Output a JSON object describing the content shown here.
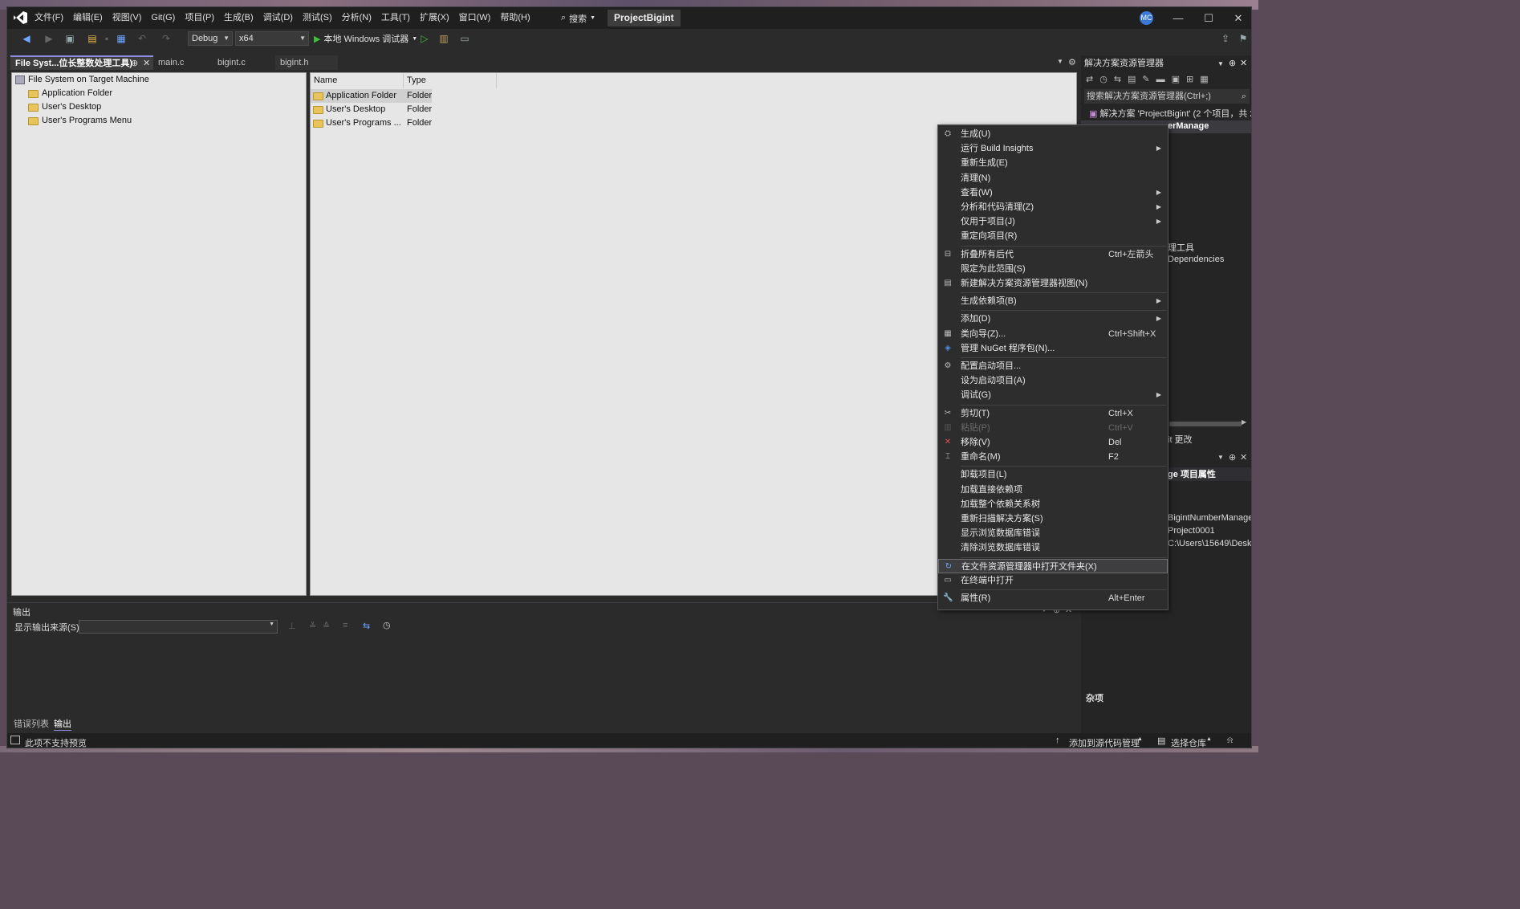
{
  "title": {
    "menus": [
      "文件(F)",
      "编辑(E)",
      "视图(V)",
      "Git(G)",
      "项目(P)",
      "生成(B)",
      "调试(D)",
      "测试(S)",
      "分析(N)",
      "工具(T)",
      "扩展(X)",
      "窗口(W)",
      "帮助(H)"
    ],
    "search": "搜索",
    "project": "ProjectBigint",
    "avatar": "MC"
  },
  "toolbar": {
    "config": "Debug",
    "platform": "x64",
    "run": "本地 Windows 调试器"
  },
  "tabs": [
    "File Syst...位长整数处理工具)",
    "main.c",
    "bigint.c",
    "bigint.h"
  ],
  "fs_tree": {
    "root": "File System on Target Machine",
    "children": [
      "Application Folder",
      "User's Desktop",
      "User's Programs Menu"
    ]
  },
  "fs_list": {
    "columns": [
      "Name",
      "Type"
    ],
    "rows": [
      {
        "name": "Application Folder",
        "type": "Folder"
      },
      {
        "name": "User's Desktop",
        "type": "Folder"
      },
      {
        "name": "User's Programs ...",
        "type": "Folder"
      }
    ]
  },
  "output": {
    "title": "输出",
    "source_label": "显示输出来源(S):"
  },
  "bottom_tabs": [
    "错误列表",
    "输出"
  ],
  "status": {
    "left": "此项不支持预览",
    "add_source": "添加到源代码管理",
    "select_repo": "选择仓库"
  },
  "solution_explorer": {
    "title": "解决方案资源管理器",
    "search_placeholder": "搜索解决方案资源管理器(Ctrl+;)",
    "solution": "解决方案 'ProjectBigint' (2 个项目，共 2",
    "project_partial": "erManage",
    "frag1": "理工具",
    "frag2": "Dependencies",
    "frag3": "it 更改",
    "frag4": "ge 项目属性",
    "frag5": "BigintNumberManage",
    "frag6": "Project0001",
    "frag7": "C:\\Users\\15649\\Deskt",
    "misc": "杂项"
  },
  "context_menu": {
    "items": [
      {
        "label": "生成(U)",
        "icon": "build-icon"
      },
      {
        "label": "运行 Build Insights",
        "sub": true
      },
      {
        "label": "重新生成(E)"
      },
      {
        "label": "清理(N)"
      },
      {
        "label": "查看(W)",
        "sub": true
      },
      {
        "label": "分析和代码清理(Z)",
        "sub": true
      },
      {
        "label": "仅用于项目(J)",
        "sub": true
      },
      {
        "label": "重定向项目(R)"
      },
      {
        "sep": true
      },
      {
        "label": "折叠所有后代",
        "shortcut": "Ctrl+左箭头",
        "icon": "collapse-icon"
      },
      {
        "label": "限定为此范围(S)"
      },
      {
        "label": "新建解决方案资源管理器视图(N)",
        "icon": "new-view-icon"
      },
      {
        "sep": true
      },
      {
        "label": "生成依赖项(B)",
        "sub": true
      },
      {
        "sep": true
      },
      {
        "label": "添加(D)",
        "sub": true
      },
      {
        "label": "类向导(Z)...",
        "shortcut": "Ctrl+Shift+X",
        "icon": "class-wizard-icon"
      },
      {
        "label": "管理 NuGet 程序包(N)...",
        "icon": "nuget-icon"
      },
      {
        "sep": true
      },
      {
        "label": "配置启动项目...",
        "icon": "gear-icon"
      },
      {
        "label": "设为启动项目(A)"
      },
      {
        "label": "调试(G)",
        "sub": true
      },
      {
        "sep": true
      },
      {
        "label": "剪切(T)",
        "shortcut": "Ctrl+X",
        "icon": "cut-icon"
      },
      {
        "label": "粘贴(P)",
        "shortcut": "Ctrl+V",
        "icon": "paste-icon",
        "disabled": true
      },
      {
        "label": "移除(V)",
        "shortcut": "Del",
        "icon": "remove-icon"
      },
      {
        "label": "重命名(M)",
        "shortcut": "F2",
        "icon": "rename-icon"
      },
      {
        "sep": true
      },
      {
        "label": "卸载项目(L)"
      },
      {
        "label": "加载直接依赖项"
      },
      {
        "label": "加载整个依赖关系树"
      },
      {
        "label": "重新扫描解决方案(S)"
      },
      {
        "label": "显示浏览数据库错误"
      },
      {
        "label": "清除浏览数据库错误"
      },
      {
        "sep": true
      },
      {
        "label": "在文件资源管理器中打开文件夹(X)",
        "icon": "open-folder-icon",
        "highlight": true
      },
      {
        "label": "在终端中打开",
        "icon": "terminal-icon"
      },
      {
        "sep": true
      },
      {
        "label": "属性(R)",
        "shortcut": "Alt+Enter",
        "icon": "wrench-icon"
      }
    ]
  }
}
